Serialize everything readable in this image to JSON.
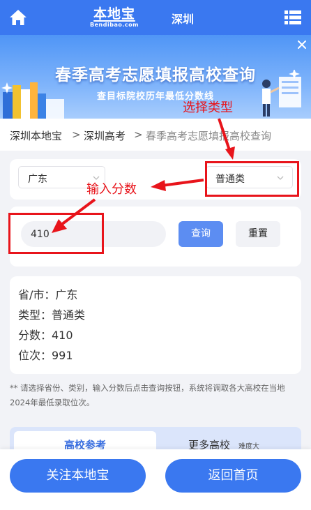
{
  "header": {
    "logo_main": "本地宝",
    "logo_sub": "Bendibao.com",
    "city": "深圳"
  },
  "banner": {
    "title": "春季高考志愿填报高校查询",
    "subtitle": "查目标院校历年最低分数线"
  },
  "breadcrumb": [
    {
      "label": "深圳本地宝"
    },
    {
      "label": "深圳高考"
    },
    {
      "label": "春季高考志愿填报高校查询"
    }
  ],
  "breadcrumb_sep": ">",
  "filters": {
    "province": "广东",
    "category": "普通类"
  },
  "score": {
    "value": "410"
  },
  "buttons": {
    "query": "查询",
    "reset": "重置"
  },
  "result": {
    "province": "省/市：广东",
    "type": "类型：普通类",
    "score": "分数：410",
    "rank": "位次：991"
  },
  "note": "** 请选择省份、类别，输入分数后点击查询按钮，系统将调取各大高校在当地2024年最低录取位次。",
  "tabs": {
    "active": "高校参考",
    "more": "更多高校",
    "difficulty": "难度大"
  },
  "bottom": {
    "follow": "关注本地宝",
    "home": "返回首页"
  },
  "annotations": {
    "select_type": "选择类型",
    "input_score": "输入分数",
    "color": "#e8141b"
  },
  "colors": {
    "primary": "#3a78f0",
    "query_button": "#5c8df2"
  }
}
